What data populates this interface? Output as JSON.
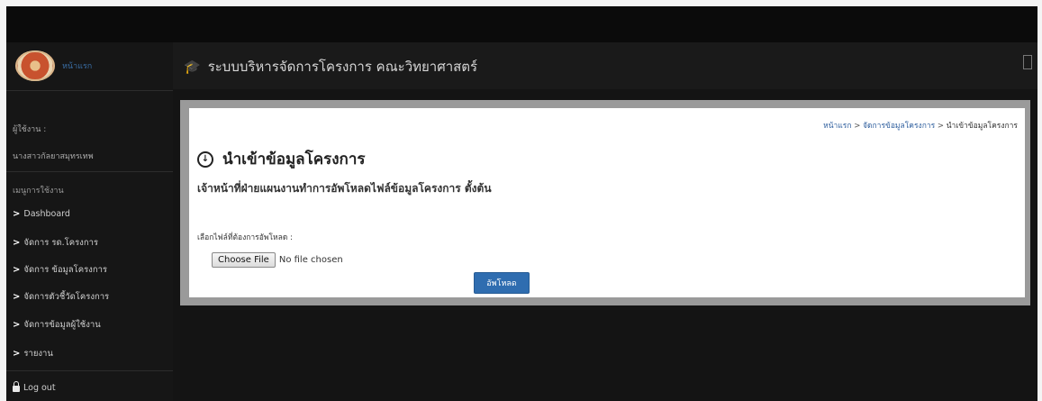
{
  "app": {
    "logo_text": "หน้าแรก",
    "title": "ระบบบริหารจัดการโครงการ คณะวิทยาศาสตร์"
  },
  "sidebar": {
    "user_label": "ผู้ใช้งาน :",
    "user_name": "นางสาวกัลยาสมุทรเทพ",
    "menu_title": "เมนูการใช้งาน",
    "items": [
      {
        "label": "Dashboard"
      },
      {
        "label": "จัดการ รด.โครงการ"
      },
      {
        "label": "จัดการ ข้อมูลโครงการ"
      },
      {
        "label": "จัดการตัวชี้วัดโครงการ"
      },
      {
        "label": "จัดการข้อมูลผู้ใช้งาน"
      },
      {
        "label": "รายงาน"
      }
    ],
    "logout_label": "Log out"
  },
  "breadcrumb": {
    "home": "หน้าแรก",
    "sep": ">",
    "section": "จัดการข้อมูลโครงการ",
    "current": "นำเข้าข้อมูลโครงการ"
  },
  "page": {
    "title": "นำเข้าข้อมูลโครงการ",
    "subtitle": "เจ้าหน้าที่ฝ่ายแผนงานทำการอัพโหลดไฟล์ข้อมูลโครงการ ตั้งต้น",
    "file_label": "เลือกไฟล์ที่ต้องการอัพโหลด :",
    "choose_file": "Choose File",
    "no_file": "No file chosen",
    "upload": "อัพโหลด"
  },
  "colors": {
    "accent": "#2f6db0",
    "sidebar_bg": "#161616",
    "page_bg": "#0f0f0f"
  },
  "icons": {
    "header": "graduation-cap-icon",
    "title": "download-circle-icon",
    "menu": "chevron-right-icon",
    "logout": "lock-icon"
  }
}
